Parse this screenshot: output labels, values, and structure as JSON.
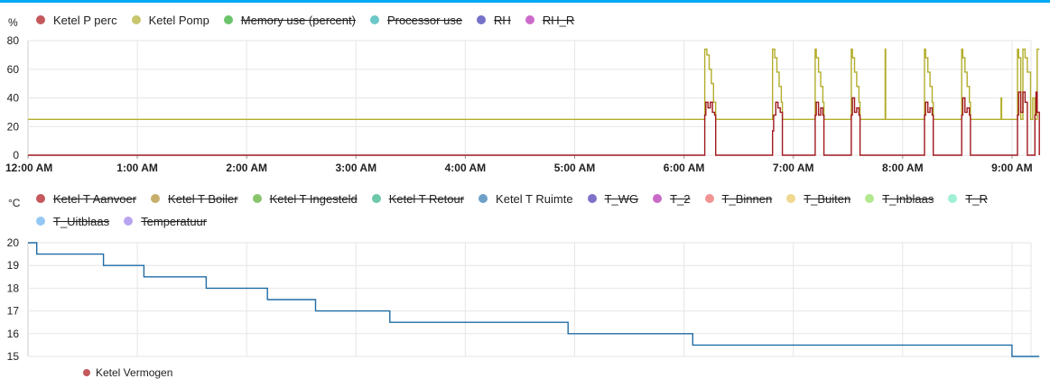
{
  "chart_data": [
    {
      "type": "line",
      "unit": "%",
      "ylim": [
        0,
        80
      ],
      "y_ticks": [
        0,
        20,
        40,
        60,
        80
      ],
      "x_tick_labels": [
        "12:00 AM",
        "1:00 AM",
        "2:00 AM",
        "3:00 AM",
        "4:00 AM",
        "5:00 AM",
        "6:00 AM",
        "7:00 AM",
        "8:00 AM",
        "9:00 AM"
      ],
      "x_range_hours": [
        0,
        9.25
      ],
      "grid": true,
      "legend_position": "top-left",
      "legend": [
        {
          "name": "Ketel P perc",
          "color": "#c4585c",
          "hidden": false
        },
        {
          "name": "Ketel Pomp",
          "color": "#c8c56c",
          "hidden": false
        },
        {
          "name": "Memory use (percent)",
          "color": "#6cc46c",
          "hidden": true
        },
        {
          "name": "Processor use",
          "color": "#6cc8c8",
          "hidden": true
        },
        {
          "name": "RH",
          "color": "#7570c8",
          "hidden": true
        },
        {
          "name": "RH_R",
          "color": "#cc6acb",
          "hidden": true
        }
      ],
      "series": [
        {
          "name": "Ketel Pomp",
          "color": "#b3ad2b",
          "x": [
            0,
            6.19,
            6.21,
            6.23,
            6.25,
            6.27,
            6.29,
            6.3,
            6.81,
            6.83,
            6.85,
            6.87,
            6.89,
            6.9,
            7.2,
            7.21,
            7.23,
            7.25,
            7.27,
            7.28,
            7.53,
            7.54,
            7.56,
            7.58,
            7.6,
            7.61,
            7.84,
            7.845,
            8.2,
            8.21,
            8.23,
            8.25,
            8.27,
            8.28,
            8.54,
            8.55,
            8.57,
            8.59,
            8.61,
            8.62,
            8.9,
            8.905,
            9.05,
            9.06,
            9.08,
            9.1,
            9.12,
            9.14,
            9.17,
            9.19,
            9.21,
            9.23,
            9.25
          ],
          "y": [
            25,
            74,
            70,
            60,
            50,
            37,
            25,
            25,
            74,
            68,
            58,
            48,
            37,
            25,
            74,
            68,
            58,
            48,
            37,
            25,
            74,
            68,
            58,
            48,
            37,
            25,
            74,
            25,
            74,
            68,
            58,
            48,
            37,
            25,
            74,
            68,
            58,
            48,
            37,
            25,
            40,
            25,
            74,
            68,
            25,
            74,
            68,
            58,
            25,
            40,
            25,
            74,
            74
          ]
        },
        {
          "name": "Ketel P perc",
          "color": "#a0181e",
          "x": [
            0,
            6.19,
            6.2,
            6.22,
            6.24,
            6.26,
            6.28,
            6.29,
            6.81,
            6.82,
            6.84,
            6.86,
            6.88,
            6.9,
            7.2,
            7.21,
            7.23,
            7.25,
            7.27,
            7.28,
            7.53,
            7.54,
            7.56,
            7.58,
            7.6,
            7.61,
            8.2,
            8.21,
            8.23,
            8.25,
            8.27,
            8.28,
            8.54,
            8.55,
            8.57,
            8.59,
            8.61,
            8.62,
            9.05,
            9.06,
            9.08,
            9.1,
            9.12,
            9.14,
            9.21,
            9.22,
            9.23,
            9.25
          ],
          "y": [
            0,
            28,
            37,
            33,
            37,
            30,
            28,
            0,
            17,
            28,
            37,
            33,
            30,
            0,
            28,
            37,
            28,
            33,
            28,
            0,
            28,
            40,
            30,
            33,
            28,
            0,
            28,
            37,
            30,
            33,
            28,
            0,
            28,
            40,
            30,
            33,
            28,
            0,
            28,
            44,
            30,
            44,
            37,
            0,
            28,
            44,
            30,
            0
          ]
        }
      ]
    },
    {
      "type": "line",
      "unit": "°C",
      "ylim": [
        15,
        20
      ],
      "y_ticks": [
        15,
        16,
        17,
        18,
        19,
        20
      ],
      "x_range_hours": [
        0,
        9.25
      ],
      "grid": true,
      "legend_position": "top-left",
      "legend": [
        {
          "name": "Ketel T Aanvoer",
          "color": "#c4585c",
          "hidden": true
        },
        {
          "name": "Ketel T Boiler",
          "color": "#c8ae6c",
          "hidden": true
        },
        {
          "name": "Ketel T Ingesteld",
          "color": "#88c46c",
          "hidden": true
        },
        {
          "name": "Ketel T Retour",
          "color": "#6cc8a8",
          "hidden": true
        },
        {
          "name": "Ketel T Ruimte",
          "color": "#6fa0c8",
          "hidden": false
        },
        {
          "name": "T_WG",
          "color": "#7f70c8",
          "hidden": true
        },
        {
          "name": "T_2",
          "color": "#c86ac8",
          "hidden": true
        },
        {
          "name": "T_Binnen",
          "color": "#f09494",
          "hidden": true
        },
        {
          "name": "T_Buiten",
          "color": "#f0d890",
          "hidden": true
        },
        {
          "name": "T_Inblaas",
          "color": "#b4e890",
          "hidden": true
        },
        {
          "name": "T_R",
          "color": "#a0f0d4",
          "hidden": true
        },
        {
          "name": "T_Uitblaas",
          "color": "#94c8f4",
          "hidden": true
        },
        {
          "name": "Temperatuur",
          "color": "#b9a4f0",
          "hidden": true
        }
      ],
      "series": [
        {
          "name": "Ketel T Ruimte",
          "color": "#1f6ca5",
          "x": [
            0,
            0.08,
            0.08,
            0.69,
            0.69,
            1.06,
            1.06,
            1.63,
            1.63,
            2.19,
            2.19,
            2.63,
            2.63,
            3.31,
            3.31,
            4.94,
            4.94,
            6.08,
            6.08,
            9.0,
            9.0,
            9.25
          ],
          "y": [
            20,
            20,
            19.5,
            19.5,
            19,
            19,
            18.5,
            18.5,
            18,
            18,
            17.5,
            17.5,
            17,
            17,
            16.5,
            16.5,
            16,
            16,
            15.5,
            15.5,
            15,
            15
          ]
        }
      ]
    }
  ],
  "partial_legend_label": "Ketel Vermogen"
}
